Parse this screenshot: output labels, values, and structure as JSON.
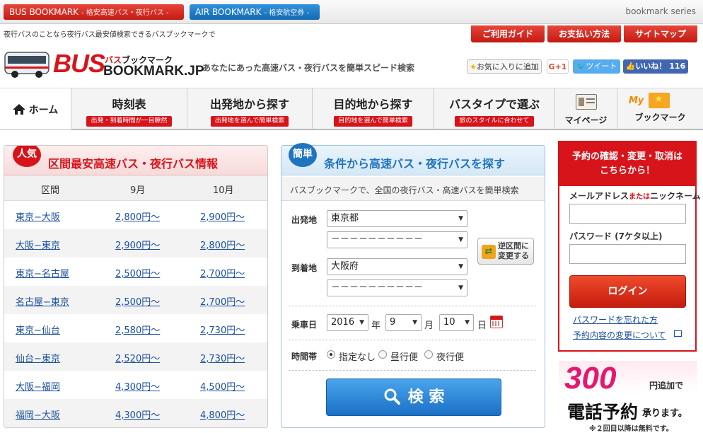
{
  "topbar": {
    "bus_label": "BUS BOOKMARK",
    "bus_sub": "- 格安高速バス・夜行バス -",
    "air_label": "AIR BOOKMARK",
    "air_sub": "- 格安航空券 -",
    "series": "bookmark series"
  },
  "tagline": "夜行バスのことなら夜行バス最安値検索できるバスブックマークで",
  "util_nav": [
    "ご利用ガイド",
    "お支払い方法",
    "サイトマップ"
  ],
  "logo": {
    "main": "BUS",
    "kana_red": "バス",
    "kana": "ブックマーク",
    "url": "BOOKMARK.JP"
  },
  "slogan": "あなたにあった高速バス・夜行バスを簡単スピード検索",
  "social": {
    "favorite": "お気に入りに追加",
    "gplus": "G+1",
    "tweet": "ツイート",
    "like": "いいね！",
    "like_count": "116"
  },
  "nav": {
    "home": "ホーム",
    "items": [
      {
        "title": "時刻表",
        "sub": "出発・到着時間が一目瞭然"
      },
      {
        "title": "出発地から探す",
        "sub": "出発地を選んで簡単検索"
      },
      {
        "title": "目的地から探す",
        "sub": "目的地を選んで簡単検索"
      },
      {
        "title": "バスタイプで選ぶ",
        "sub": "旅のスタイルに合わせて"
      }
    ],
    "mypage": "マイページ",
    "bookmark_badge": "My",
    "bookmark": "ブックマーク"
  },
  "popular": {
    "badge": "人気",
    "title": "区間最安高速バス・夜行バス情報",
    "headers": [
      "区間",
      "9月",
      "10月"
    ],
    "rows": [
      {
        "route": "東京−大阪",
        "sep": "2,800円〜",
        "oct": "2,900円〜"
      },
      {
        "route": "大阪−東京",
        "sep": "2,900円〜",
        "oct": "2,800円〜"
      },
      {
        "route": "東京−名古屋",
        "sep": "2,500円〜",
        "oct": "2,700円〜"
      },
      {
        "route": "名古屋−東京",
        "sep": "2,500円〜",
        "oct": "2,700円〜"
      },
      {
        "route": "東京−仙台",
        "sep": "2,580円〜",
        "oct": "2,730円〜"
      },
      {
        "route": "仙台−東京",
        "sep": "2,520円〜",
        "oct": "2,730円〜"
      },
      {
        "route": "大阪−福岡",
        "sep": "4,300円〜",
        "oct": "4,500円〜"
      },
      {
        "route": "福岡−大阪",
        "sep": "4,300円〜",
        "oct": "4,800円〜"
      }
    ]
  },
  "search": {
    "badge": "簡単",
    "title": "条件から高速バス・夜行バスを探す",
    "subtitle": "バスブックマークで、全国の夜行バス・高速バスを簡単検索",
    "depart_label": "出発地",
    "depart_pref": "東京都",
    "depart_city": "－－－－－－－－－－",
    "arrive_label": "到着地",
    "arrive_pref": "大阪府",
    "arrive_city": "－－－－－－－－－－",
    "swap_line1": "逆区間に",
    "swap_line2": "変更する",
    "date_label": "乗車日",
    "year": "2016",
    "year_unit": "年",
    "month": "9",
    "month_unit": "月",
    "day": "10",
    "day_unit": "日",
    "time_label": "時間帯",
    "time_options": [
      "指定なし",
      "昼行便",
      "夜行便"
    ],
    "time_selected": "指定なし",
    "search_button": "検 索"
  },
  "login": {
    "title_line1": "予約の確認・変更・取消は",
    "title_line2": "こちらから！",
    "email_label_a": "メールアドレス",
    "email_label_or": "または",
    "email_label_b": "ニックネーム",
    "password_label": "パスワード (7ケタ以上)",
    "login_button": "ログイン",
    "forgot": "パスワードを忘れた方",
    "change": "予約内容の変更について"
  },
  "promo": {
    "amount": "300",
    "suffix": "円追加で",
    "main": "電話予約",
    "main_suffix": "承ります。",
    "note": "※２回目以降は無料です。"
  }
}
